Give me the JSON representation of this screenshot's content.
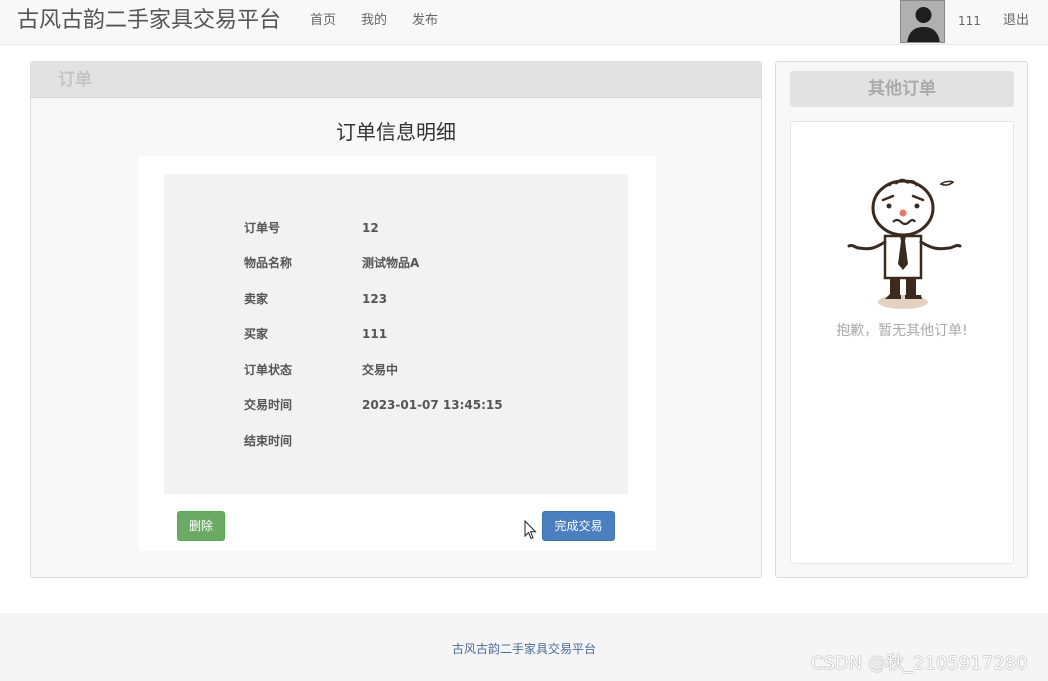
{
  "navbar": {
    "brand": "古风古韵二手家具交易平台",
    "links": [
      {
        "label": "首页"
      },
      {
        "label": "我的"
      },
      {
        "label": "发布"
      }
    ],
    "user": "111",
    "logout": "退出"
  },
  "order_panel": {
    "title": "订单",
    "detail_title": "订单信息明细",
    "rows": [
      {
        "label": "订单号",
        "value": "12"
      },
      {
        "label": "物品名称",
        "value": "测试物品A"
      },
      {
        "label": "卖家",
        "value": "123"
      },
      {
        "label": "买家",
        "value": "111"
      },
      {
        "label": "订单状态",
        "value": "交易中"
      },
      {
        "label": "交易时间",
        "value": "2023-01-07 13:45:15"
      },
      {
        "label": "结束时间",
        "value": ""
      }
    ],
    "delete_label": "删除",
    "complete_label": "完成交易"
  },
  "side_panel": {
    "title": "其他订单",
    "empty_message": "抱歉，暂无其他订单!"
  },
  "footer": {
    "text": "古风古韵二手家具交易平台",
    "watermark": "CSDN @秋_2105917280"
  }
}
